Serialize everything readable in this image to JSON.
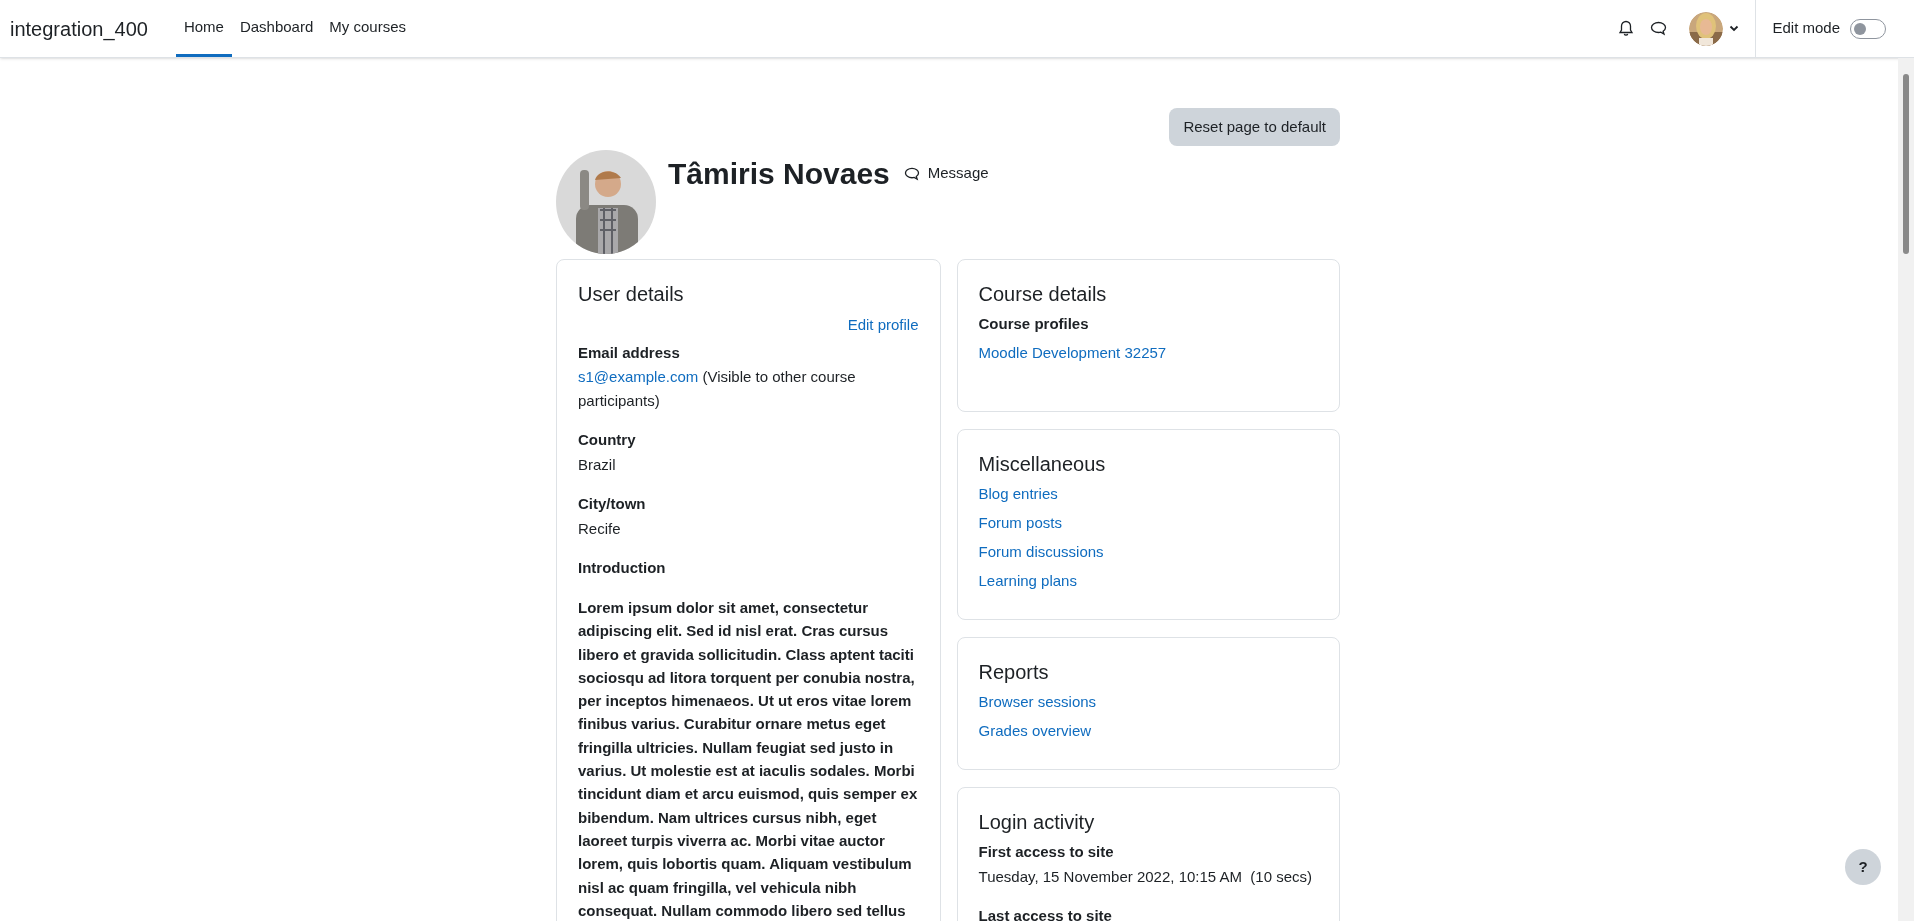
{
  "navbar": {
    "site_name": "integration_400",
    "items": [
      {
        "label": "Home",
        "selected": true
      },
      {
        "label": "Dashboard",
        "selected": false
      },
      {
        "label": "My courses",
        "selected": false
      }
    ],
    "edit_mode": {
      "label": "Edit mode",
      "on": false
    }
  },
  "reset_button": "Reset page to default",
  "profile": {
    "name": "Tâmiris Novaes",
    "message_link": "Message"
  },
  "user_details": {
    "title": "User details",
    "edit_link": "Edit profile",
    "fields": [
      {
        "kind": "email",
        "label": "Email address",
        "link": "s1@example.com",
        "note": "(Visible to other course participants)"
      },
      {
        "kind": "text",
        "label": "Country",
        "value": "Brazil"
      },
      {
        "kind": "text",
        "label": "City/town",
        "value": "Recife"
      },
      {
        "kind": "intro",
        "label": "Introduction",
        "value": "Lorem ipsum dolor sit amet, consectetur adipiscing elit. Sed id nisl erat. Cras cursus libero et gravida sollicitudin. Class aptent taciti sociosqu ad litora torquent per conubia nostra, per inceptos himenaeos. Ut ut eros vitae lorem finibus varius. Curabitur ornare metus eget fringilla ultricies. Nullam feugiat sed justo in varius. Ut molestie est at iaculis sodales. Morbi tincidunt diam et arcu euismod, quis semper ex bibendum. Nam ultrices cursus nibh, eget laoreet turpis viverra ac. Morbi vitae auctor lorem, quis lobortis quam. Aliquam vestibulum nisl ac quam fringilla, vel vehicula nibh consequat. Nullam commodo libero sed tellus"
      }
    ]
  },
  "side_cards": [
    {
      "kind": "links",
      "title": "Course details",
      "subtitle": "Course profiles",
      "links": [
        "Moodle Development 32257"
      ]
    },
    {
      "kind": "links",
      "title": "Miscellaneous",
      "links": [
        "Blog entries",
        "Forum posts",
        "Forum discussions",
        "Learning plans"
      ]
    },
    {
      "kind": "links",
      "title": "Reports",
      "links": [
        "Browser sessions",
        "Grades overview"
      ]
    },
    {
      "kind": "fields",
      "title": "Login activity",
      "fields": [
        {
          "label": "First access to site",
          "value": "Tuesday, 15 November 2022, 10:15 AM  (10 secs)"
        },
        {
          "label": "Last access to site"
        }
      ]
    }
  ],
  "help_button": "?"
}
